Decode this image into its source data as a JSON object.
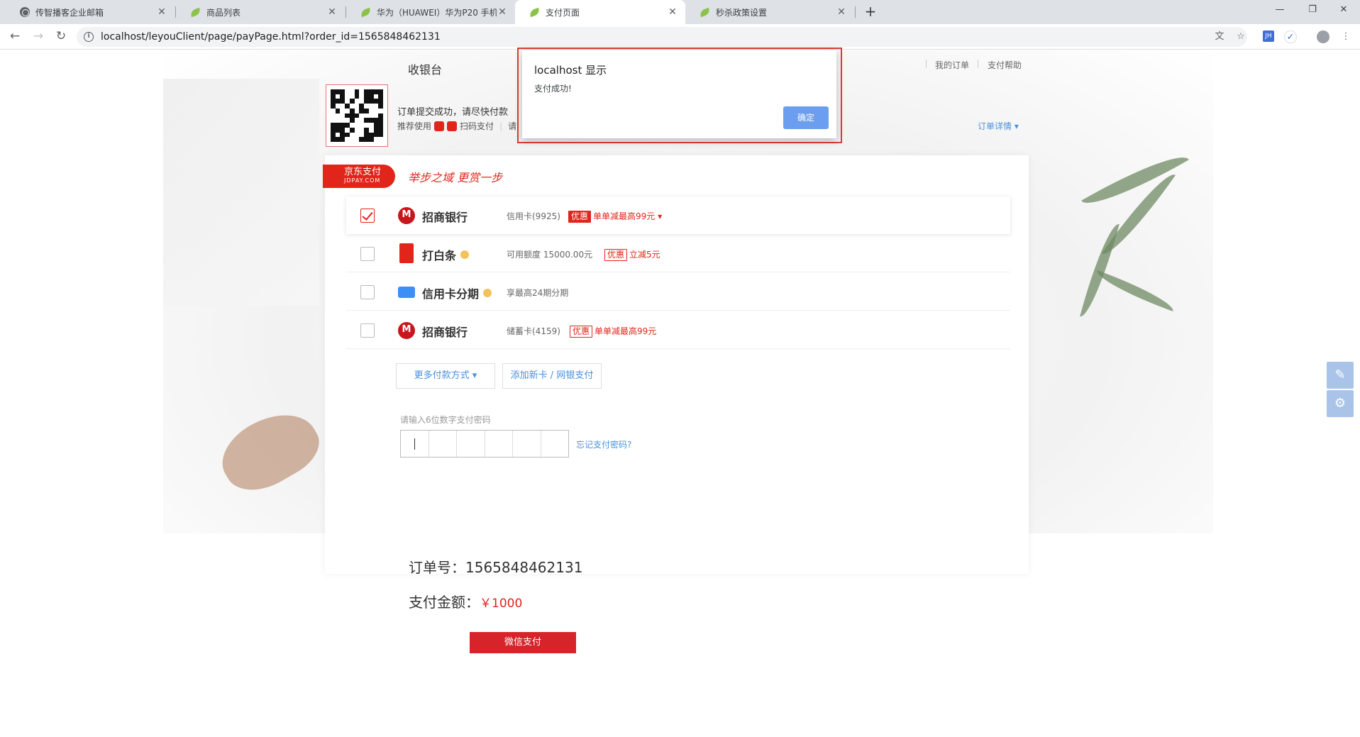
{
  "browser": {
    "tabs": [
      {
        "title": "传智播客企业邮箱",
        "icon": "globe-icon",
        "active": false
      },
      {
        "title": "商品列表",
        "icon": "leaf-icon",
        "active": false
      },
      {
        "title": "华为（HUAWEI）华为P20 手机",
        "icon": "leaf-icon",
        "active": false
      },
      {
        "title": "支付页面",
        "icon": "leaf-icon",
        "active": true
      },
      {
        "title": "秒杀政策设置",
        "icon": "leaf-icon",
        "active": false
      }
    ],
    "close_glyph": "✕",
    "new_tab_glyph": "+",
    "url": "localhost/leyouClient/page/payPage.html?order_id=1565848462131",
    "extension_badge": "JH"
  },
  "header": {
    "cashier_title": "收银台",
    "my_orders": "我的订单",
    "pay_help": "支付帮助",
    "order_tip": "订单提交成功，请尽快付款",
    "recommend_prefix": "推荐使用",
    "recommend_scan": "扫码支付",
    "recommend_sep": "|",
    "recommend_more": "请",
    "order_detail": "订单详情 ▾"
  },
  "jdpay": {
    "logo_text": "京东支付",
    "logo_sub": "JDPAY.COM",
    "slogan": "举步之域 更赏一步"
  },
  "methods": [
    {
      "name": "招商银行",
      "desc": "信用卡(9925)",
      "promo_tag": "优惠",
      "promo_text": "单单减最高99元 ▾",
      "checked": true,
      "icon": "cmb-bank-icon"
    },
    {
      "name": "打白条",
      "desc": "可用额度  15000.00元",
      "promo_tag": "优惠",
      "promo_text": "立减5元",
      "checked": false,
      "icon": "baitiao-icon"
    },
    {
      "name": "信用卡分期",
      "desc": "享最高24期分期",
      "promo_tag": "",
      "promo_text": "",
      "checked": false,
      "icon": "credit-card-icon"
    },
    {
      "name": "招商银行",
      "desc": "储蓄卡(4159)",
      "promo_tag": "优惠",
      "promo_text": "单单减最高99元",
      "checked": false,
      "icon": "cmb-bank-icon"
    }
  ],
  "actions": {
    "more_methods": "更多付款方式 ▾",
    "add_card": "添加新卡 / 网银支付"
  },
  "password": {
    "label": "请输入6位数字支付密码",
    "forgot": "忘记支付密码?"
  },
  "order": {
    "order_no_label": "订单号：",
    "order_no": "1565848462131",
    "amount_label": "支付金额：",
    "amount": "￥1000",
    "wechat_pay": "微信支付"
  },
  "dialog": {
    "title": "localhost 显示",
    "message": "支付成功!",
    "ok": "确定"
  },
  "colors": {
    "accent_red": "#e1251b",
    "link_blue": "#4a90d9",
    "dialog_button": "#6c9ef0"
  }
}
